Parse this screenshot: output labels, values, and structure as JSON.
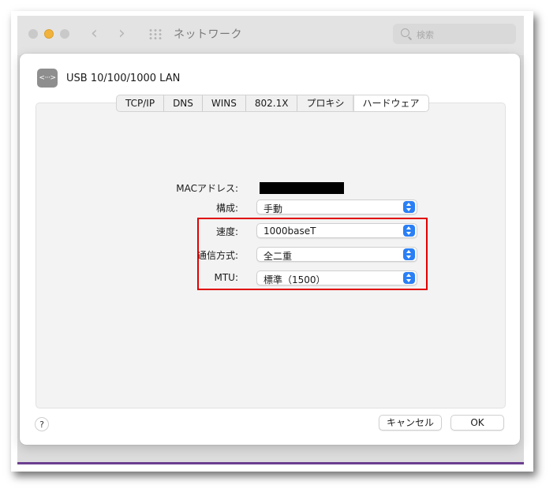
{
  "window": {
    "title": "ネットワーク",
    "search_placeholder": "検索"
  },
  "interface": {
    "title": "USB 10/100/1000 LAN",
    "icon_glyph": "<···>"
  },
  "tabs": [
    {
      "label": "TCP/IP"
    },
    {
      "label": "DNS"
    },
    {
      "label": "WINS"
    },
    {
      "label": "802.1X"
    },
    {
      "label": "プロキシ"
    },
    {
      "label": "ハードウェア",
      "active": true
    }
  ],
  "hardware": {
    "mac_label": "MACアドレス:",
    "config_label": "構成:",
    "config_value": "手動",
    "speed_label": "速度:",
    "speed_value": "1000baseT",
    "duplex_label": "通信方式:",
    "duplex_value": "全二重",
    "mtu_label": "MTU:",
    "mtu_value": "標準（1500）"
  },
  "buttons": {
    "help": "?",
    "cancel": "キャンセル",
    "ok": "OK"
  },
  "colors": {
    "accent": "#2a7ff5",
    "highlight": "#e00000"
  }
}
